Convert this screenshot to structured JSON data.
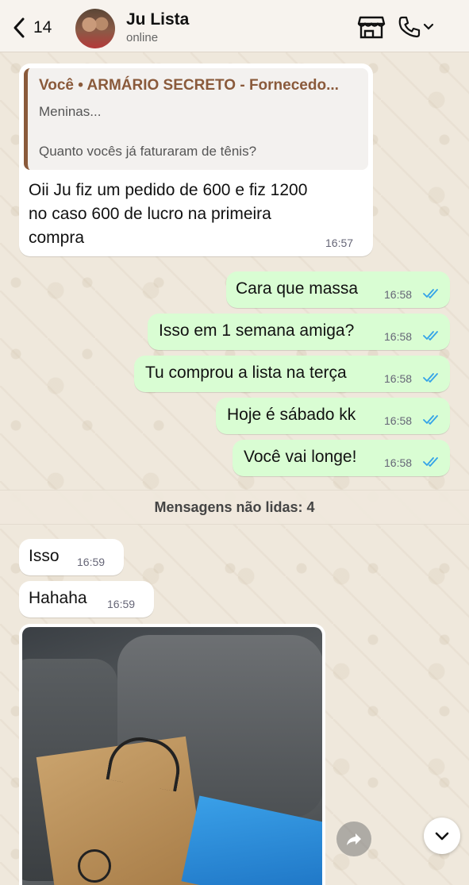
{
  "header": {
    "back_count": "14",
    "contact_name": "Ju Lista",
    "status": "online"
  },
  "messages": {
    "quoted": {
      "title": "Você • ARMÁRIO SECRETO - Fornecedo...",
      "line1": "Meninas...",
      "line2": "Quanto vocês já faturaram de tênis?"
    },
    "m1": {
      "line1": "Oii Ju fiz um pedido de 600 e fiz 1200",
      "line2": "no caso 600 de lucro na primeira",
      "line3": "compra",
      "time": "16:57"
    },
    "m2": {
      "text": "Cara que massa",
      "time": "16:58"
    },
    "m3": {
      "text": "Isso em 1 semana amiga?",
      "time": "16:58"
    },
    "m4": {
      "text": "Tu comprou a lista na terça",
      "time": "16:58"
    },
    "m5": {
      "text": "Hoje é sábado kk",
      "time": "16:58"
    },
    "m6": {
      "text": "Você vai longe!",
      "time": "16:58"
    },
    "unread_label": "Mensagens não lidas: 4",
    "m7": {
      "text": "Isso",
      "time": "16:59"
    },
    "m8": {
      "text": "Hahaha",
      "time": "16:59"
    }
  },
  "colors": {
    "incoming_bubble": "#ffffff",
    "outgoing_bubble": "#d9fdd3",
    "read_ticks": "#34a3e8",
    "quote_accent": "#8a5a3b"
  },
  "icons": [
    "chevron-left-icon",
    "store-icon",
    "phone-icon",
    "chevron-down-icon",
    "double-check-icon",
    "forward-icon"
  ]
}
